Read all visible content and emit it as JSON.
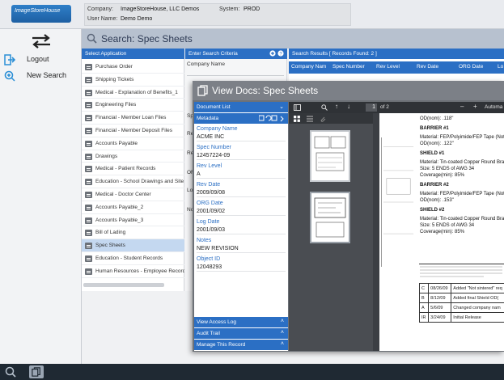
{
  "header": {
    "logo_text": "ImageStoreHouse",
    "company_label": "Company:",
    "company_value": "ImageStoreHouse, LLC Demos",
    "user_label": "User Name:",
    "user_value": "Demo Demo",
    "system_label": "System:",
    "system_value": "PROD"
  },
  "nav": {
    "logout_label": "Logout",
    "new_search_label": "New Search"
  },
  "page": {
    "title": "Search: Spec Sheets"
  },
  "apps": {
    "header": "Select Application",
    "items": [
      "Purchase Order",
      "Shipping Tickets",
      "Medical - Explanation of Benefits_1",
      "Engineering Files",
      "Financial - Member Loan Files",
      "Financial - Member Deposit Files",
      "Accounts Payable",
      "Drawings",
      "Medical - Patient Records",
      "Education - School Drawings and Site",
      "Medical - Doctor Center",
      "Accounts Payable_2",
      "Accounts Payable_3",
      "Bill of Lading",
      "Spec Sheets",
      "Education - Student Records",
      "Human Resources - Employee Record"
    ],
    "selected_index": 14
  },
  "criteria": {
    "header": "Enter Search Criteria",
    "first_field": "Company Name",
    "partial_labels": [
      "Sp",
      "Re",
      "Re",
      "OR",
      "Lo",
      "No"
    ]
  },
  "results": {
    "header": "Search Results [ Records Found: 2 ]",
    "columns": [
      "Company Nam",
      "Spec Number",
      "Rev Level",
      "Rev Date",
      "ORG Date",
      "Lo"
    ]
  },
  "modal": {
    "title": "View Docs: Spec Sheets",
    "document_list_label": "Document List",
    "metadata_label": "Metadata",
    "fields": [
      {
        "label": "Company Name",
        "value": "ACME INC"
      },
      {
        "label": "Spec Number",
        "value": "12457224-09"
      },
      {
        "label": "Rev Level",
        "value": "A"
      },
      {
        "label": "Rev Date",
        "value": "2009/09/08"
      },
      {
        "label": "ORG Date",
        "value": "2001/09/02"
      },
      {
        "label": "Log Date",
        "value": "2001/09/03"
      },
      {
        "label": "Notes",
        "value": "NEW REVISION"
      },
      {
        "label": "Object ID",
        "value": "12048293"
      }
    ],
    "footer_items": [
      "View Access Log",
      "Audit Trail",
      "Manage This Record"
    ]
  },
  "viewer": {
    "page_current": "1",
    "page_total": "of 2",
    "zoom_label": "Automa",
    "page_lines": [
      {
        "text": "OD(nom):  .118\"",
        "bold": false
      },
      {
        "text": "BARRIER #1",
        "bold": true
      },
      {
        "text": "Material:  FEP/Polyimide/FEP Tape (Not",
        "bold": false
      },
      {
        "text": "OD(nom):  .122\"",
        "bold": false
      },
      {
        "text": "SHIELD #1",
        "bold": true
      },
      {
        "text": "Material:  Tin-coated Copper Round Braid",
        "bold": false
      },
      {
        "text": "Size:  5 ENDS of AWG 34",
        "bold": false
      },
      {
        "text": "Coverage(min):  85%",
        "bold": false
      },
      {
        "text": "BARRIER #2",
        "bold": true
      },
      {
        "text": "Material:  FEP/Polyimide/FEP Tape (Not",
        "bold": false
      },
      {
        "text": "OD(nom):  .153\"",
        "bold": false
      },
      {
        "text": "SHIELD #2",
        "bold": true
      },
      {
        "text": "Material:  Tin-coated Copper Round Braid",
        "bold": false
      },
      {
        "text": "Size:  5 ENDS of AWG 34",
        "bold": false
      },
      {
        "text": "Coverage(min):  85%",
        "bold": false
      }
    ],
    "revisions": [
      {
        "rev": "C",
        "date": "08/26/09",
        "desc": "Added \"Not sintered\" req"
      },
      {
        "rev": "B",
        "date": "8/12/09",
        "desc": "Added final Shield OD("
      },
      {
        "rev": "A",
        "date": "5/6/09",
        "desc": "Changed company nam"
      },
      {
        "rev": "IR",
        "date": "3/24/09",
        "desc": "Initial Release"
      }
    ]
  },
  "colors": {
    "accent_blue": "#2b6fc4",
    "title_bar": "#b7c1cf",
    "modal_gray": "#6d7177",
    "bottom_bar": "#1f2933"
  }
}
